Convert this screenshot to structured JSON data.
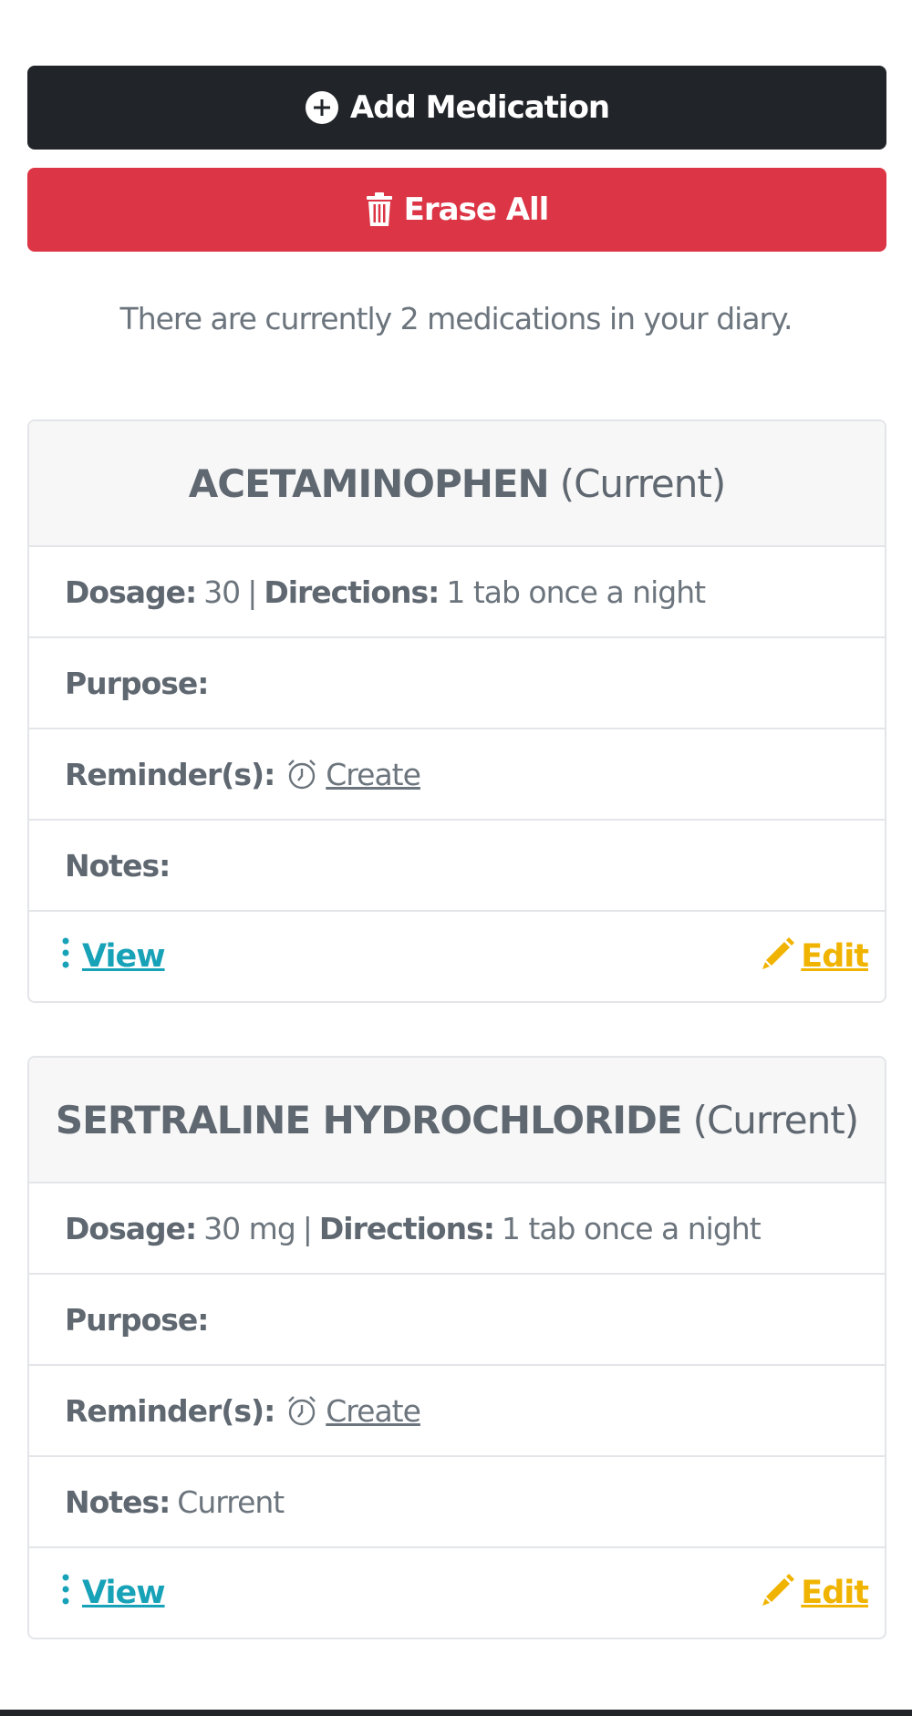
{
  "actions": {
    "add_label": "Add Medication",
    "erase_label": "Erase All"
  },
  "summary": "There are currently 2 medications in your diary.",
  "labels": {
    "dosage": "Dosage:",
    "directions": "Directions:",
    "separator": "|",
    "purpose": "Purpose:",
    "reminders": "Reminder(s):",
    "create": "Create",
    "notes": "Notes:",
    "view": "View",
    "edit": "Edit"
  },
  "medications": [
    {
      "name": "ACETAMINOPHEN",
      "status": "(Current)",
      "dosage": "30",
      "directions": "1 tab once a night",
      "purpose": "",
      "notes": ""
    },
    {
      "name": "SERTRALINE HYDROCHLORIDE",
      "status": "(Current)",
      "dosage": "30 mg",
      "directions": "1 tab once a night",
      "purpose": "",
      "notes": "Current"
    }
  ],
  "colors": {
    "primary_dark": "#212529",
    "danger": "#dc3545",
    "info": "#17a2b8",
    "warning": "#f0b400",
    "muted": "#6c757d"
  },
  "icons": {
    "add": "plus-circle-icon",
    "erase": "trash-icon",
    "reminder": "alarm-clock-icon",
    "view": "kebab-vertical-icon",
    "edit": "pencil-icon"
  }
}
